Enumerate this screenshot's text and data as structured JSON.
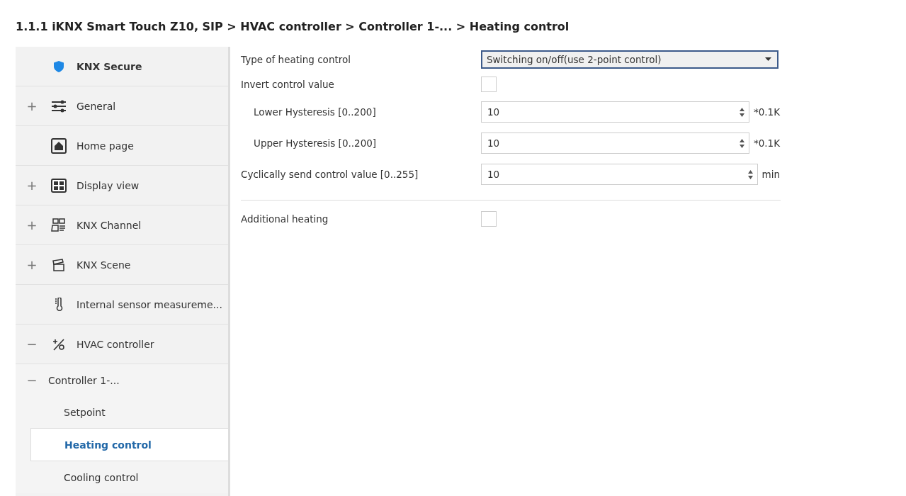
{
  "breadcrumb": "1.1.1 iKNX Smart Touch Z10, SIP > HVAC controller > Controller 1-... > Heating control",
  "sidebar": {
    "items": [
      {
        "label": "KNX Secure",
        "bold": true
      },
      {
        "label": "General",
        "toggle": "+",
        "bold": false
      },
      {
        "label": "Home page",
        "bold": false
      },
      {
        "label": "Display view",
        "toggle": "+",
        "bold": false
      },
      {
        "label": "KNX Channel",
        "toggle": "+",
        "bold": false
      },
      {
        "label": "KNX Scene",
        "toggle": "+",
        "bold": false
      },
      {
        "label": "Internal sensor measureme...",
        "bold": false
      },
      {
        "label": "HVAC controller",
        "toggle": "−",
        "bold": false,
        "children": [
          {
            "label": "Controller 1-...",
            "toggle": "−",
            "children": [
              {
                "label": "Setpoint",
                "selected": false
              },
              {
                "label": "Heating control",
                "selected": true
              },
              {
                "label": "Cooling control",
                "selected": false
              }
            ]
          }
        ]
      }
    ]
  },
  "parameters": {
    "groups": [
      {
        "rows": [
          {
            "kind": "dropdown",
            "label": "Type of heating control",
            "value": "Switching on/off(use 2-point control)",
            "focused": true
          },
          {
            "kind": "checkbox",
            "label": "Invert control value",
            "checked": false,
            "children": [
              {
                "kind": "spinner",
                "label": "Lower Hysteresis [0..200]",
                "value": "10",
                "unit": "*0.1K"
              },
              {
                "kind": "spinner",
                "label": "Upper Hysteresis [0..200]",
                "value": "10",
                "unit": "*0.1K"
              }
            ]
          },
          {
            "kind": "spinner",
            "label": "Cyclically send control value [0..255]",
            "value": "10",
            "unit": "min"
          }
        ]
      },
      {
        "rows": [
          {
            "kind": "checkbox",
            "label": "Additional heating",
            "checked": false
          }
        ]
      }
    ]
  }
}
